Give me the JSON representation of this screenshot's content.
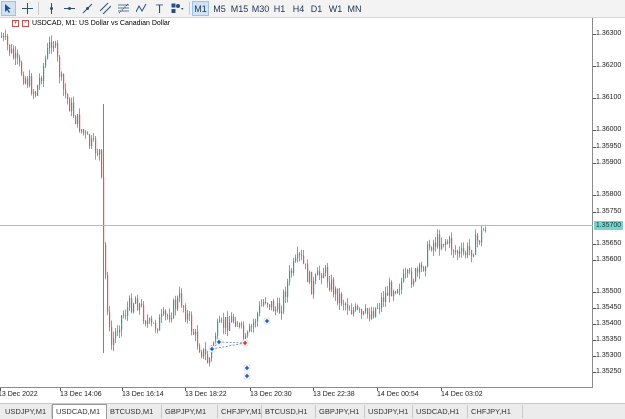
{
  "toolbar": {
    "tools": [
      "cursor-icon",
      "crosshair-icon",
      "vertical-line-icon",
      "horizontal-line-icon",
      "trendline-icon",
      "channel-icon",
      "fibonacci-icon",
      "pattern-icon",
      "text-icon",
      "shapes-icon"
    ],
    "timeframes": [
      {
        "label": "M1",
        "active": true
      },
      {
        "label": "M5",
        "active": false
      },
      {
        "label": "M15",
        "active": false
      },
      {
        "label": "M30",
        "active": false
      },
      {
        "label": "H1",
        "active": false
      },
      {
        "label": "H4",
        "active": false
      },
      {
        "label": "D1",
        "active": false
      },
      {
        "label": "W1",
        "active": false
      },
      {
        "label": "MN",
        "active": false
      }
    ]
  },
  "chart": {
    "symbol_title": "USDCAD, M1:  US Dollar vs Canadian Dollar",
    "current_price": "1.35700",
    "price_labels": [
      "1.36300",
      "1.36200",
      "1.36100",
      "1.36000",
      "1.35950",
      "1.35900",
      "1.35800",
      "1.35750",
      "1.35650",
      "1.35600",
      "1.35500",
      "1.35450",
      "1.35400",
      "1.35350",
      "1.35300",
      "1.35250"
    ],
    "time_labels": [
      "13 Dec 2022",
      "13 Dec 14:06",
      "13 Dec 16:14",
      "13 Dec 18:22",
      "13 Dec 20:30",
      "13 Dec 22:38",
      "14 Dec 00:54",
      "14 Dec 03:02"
    ],
    "colors": {
      "bull": "#26a69a",
      "bear": "#ef5350",
      "price_line": "#7ad3cf",
      "marker_buy": "#1e62c8",
      "marker_sell": "#d83a3a"
    }
  },
  "chart_data": {
    "type": "candlestick",
    "ylim": [
      1.3522,
      1.3637
    ],
    "x_labels": [
      "13 Dec 2022",
      "13 Dec 14:06",
      "13 Dec 16:14",
      "13 Dec 18:22",
      "13 Dec 20:30",
      "13 Dec 22:38",
      "14 Dec 00:54",
      "14 Dec 03:02"
    ],
    "last_price": 1.357,
    "grid": false
  },
  "tabs": [
    {
      "label": "USDJPY,M1",
      "active": false
    },
    {
      "label": "USDCAD,M1",
      "active": true
    },
    {
      "label": "BTCUSD,M1",
      "active": false
    },
    {
      "label": "GBPJPY,M1",
      "active": false
    },
    {
      "label": "CHFJPY,M1",
      "active": false
    },
    {
      "label": "BTCUSD,H1",
      "active": false
    },
    {
      "label": "GBPJPY,H1",
      "active": false
    },
    {
      "label": "USDJPY,H1",
      "active": false
    },
    {
      "label": "USDCAD,H1",
      "active": false
    },
    {
      "label": "CHFJPY,H1",
      "active": false
    }
  ]
}
